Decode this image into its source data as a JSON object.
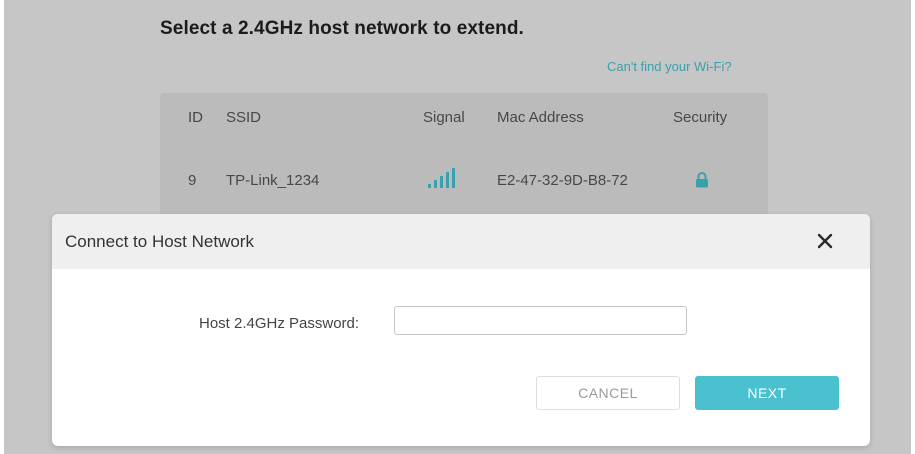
{
  "page": {
    "title": "Select a 2.4GHz host network to extend.",
    "cant_find_link": "Can't find your Wi-Fi?"
  },
  "network_table": {
    "columns": [
      "ID",
      "SSID",
      "Signal",
      "Mac Address",
      "Security"
    ],
    "rows": [
      {
        "id": "9",
        "ssid": "TP-Link_1234",
        "signal_icon": "signal-bars-icon",
        "mac": "E2-47-32-9D-B8-72",
        "security_icon": "lock-icon"
      }
    ]
  },
  "modal": {
    "title": "Connect to Host Network",
    "password_label": "Host 2.4GHz Password:",
    "password_value": "",
    "cancel_label": "CANCEL",
    "next_label": "NEXT"
  },
  "colors": {
    "accent": "#4bc0cf",
    "link": "#3aa7b3",
    "background": "#cdcdcd"
  }
}
